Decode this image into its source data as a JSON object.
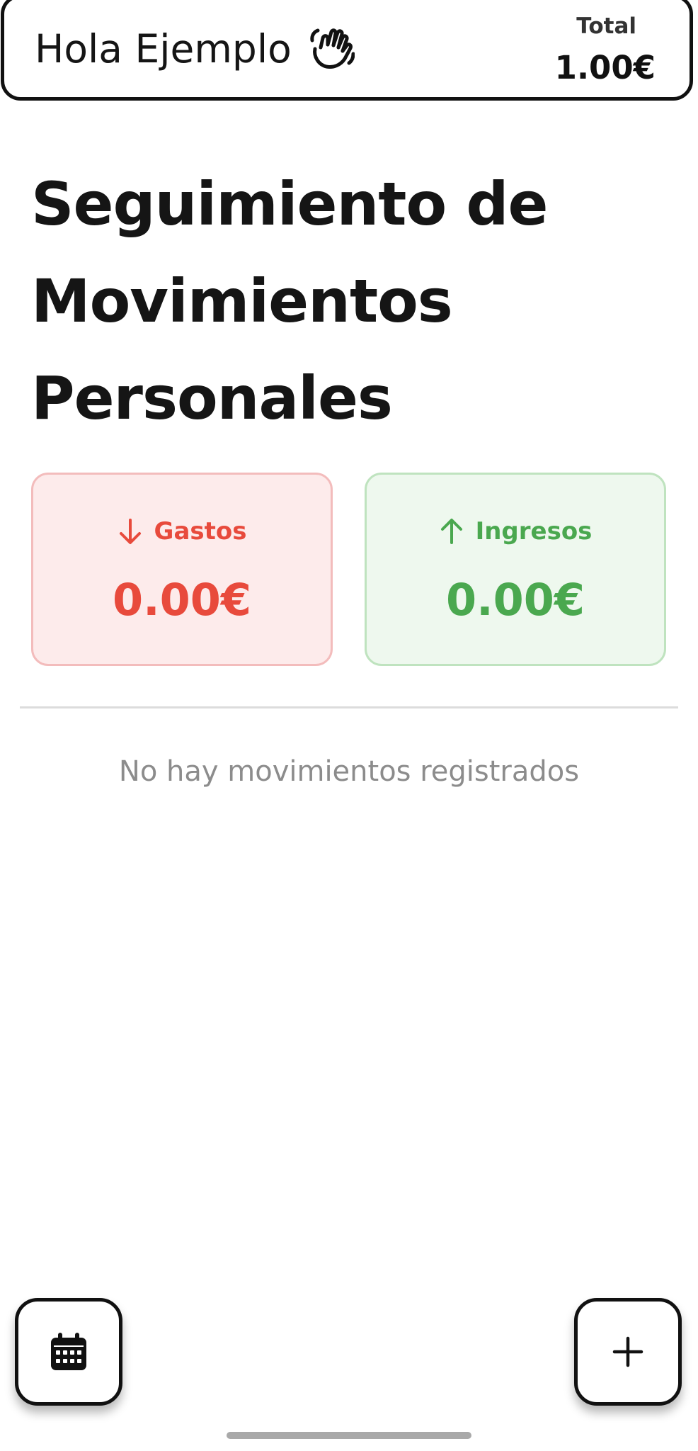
{
  "header": {
    "greeting": "Hola Ejemplo",
    "greeting_icon": "waving-hand-icon",
    "total_label": "Total",
    "total_value": "1.00€"
  },
  "page": {
    "title": "Seguimiento de Movimientos Personales"
  },
  "summary": {
    "gastos": {
      "label": "Gastos",
      "value": "0.00€",
      "icon": "arrow-down-icon",
      "color": "#e84a3c",
      "background": "#fdebeb"
    },
    "ingresos": {
      "label": "Ingresos",
      "value": "0.00€",
      "icon": "arrow-up-icon",
      "color": "#4aa84f",
      "background": "#eef8ee"
    }
  },
  "movements": {
    "empty_message": "No hay movimientos registrados",
    "items": []
  },
  "actions": {
    "calendar_icon": "calendar-icon",
    "add_icon": "plus-icon"
  }
}
